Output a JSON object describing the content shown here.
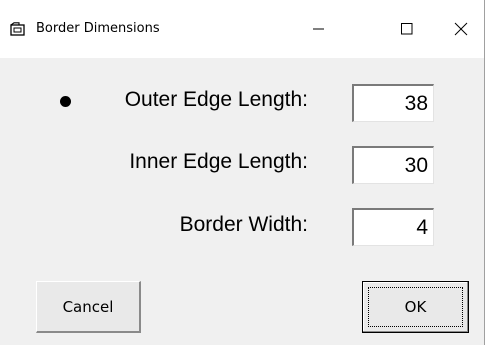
{
  "window": {
    "title": "Border Dimensions",
    "icon": "window-app-icon",
    "controls": {
      "minimize": "–",
      "maximize": "☐",
      "close": "✕"
    }
  },
  "form": {
    "fields": [
      {
        "label": "Outer Edge Length:",
        "value": "38",
        "selected": true
      },
      {
        "label": "Inner Edge Length:",
        "value": "30",
        "selected": false
      },
      {
        "label": "Border Width:",
        "value": "4",
        "selected": false
      }
    ]
  },
  "buttons": {
    "cancel": "Cancel",
    "ok": "OK"
  }
}
